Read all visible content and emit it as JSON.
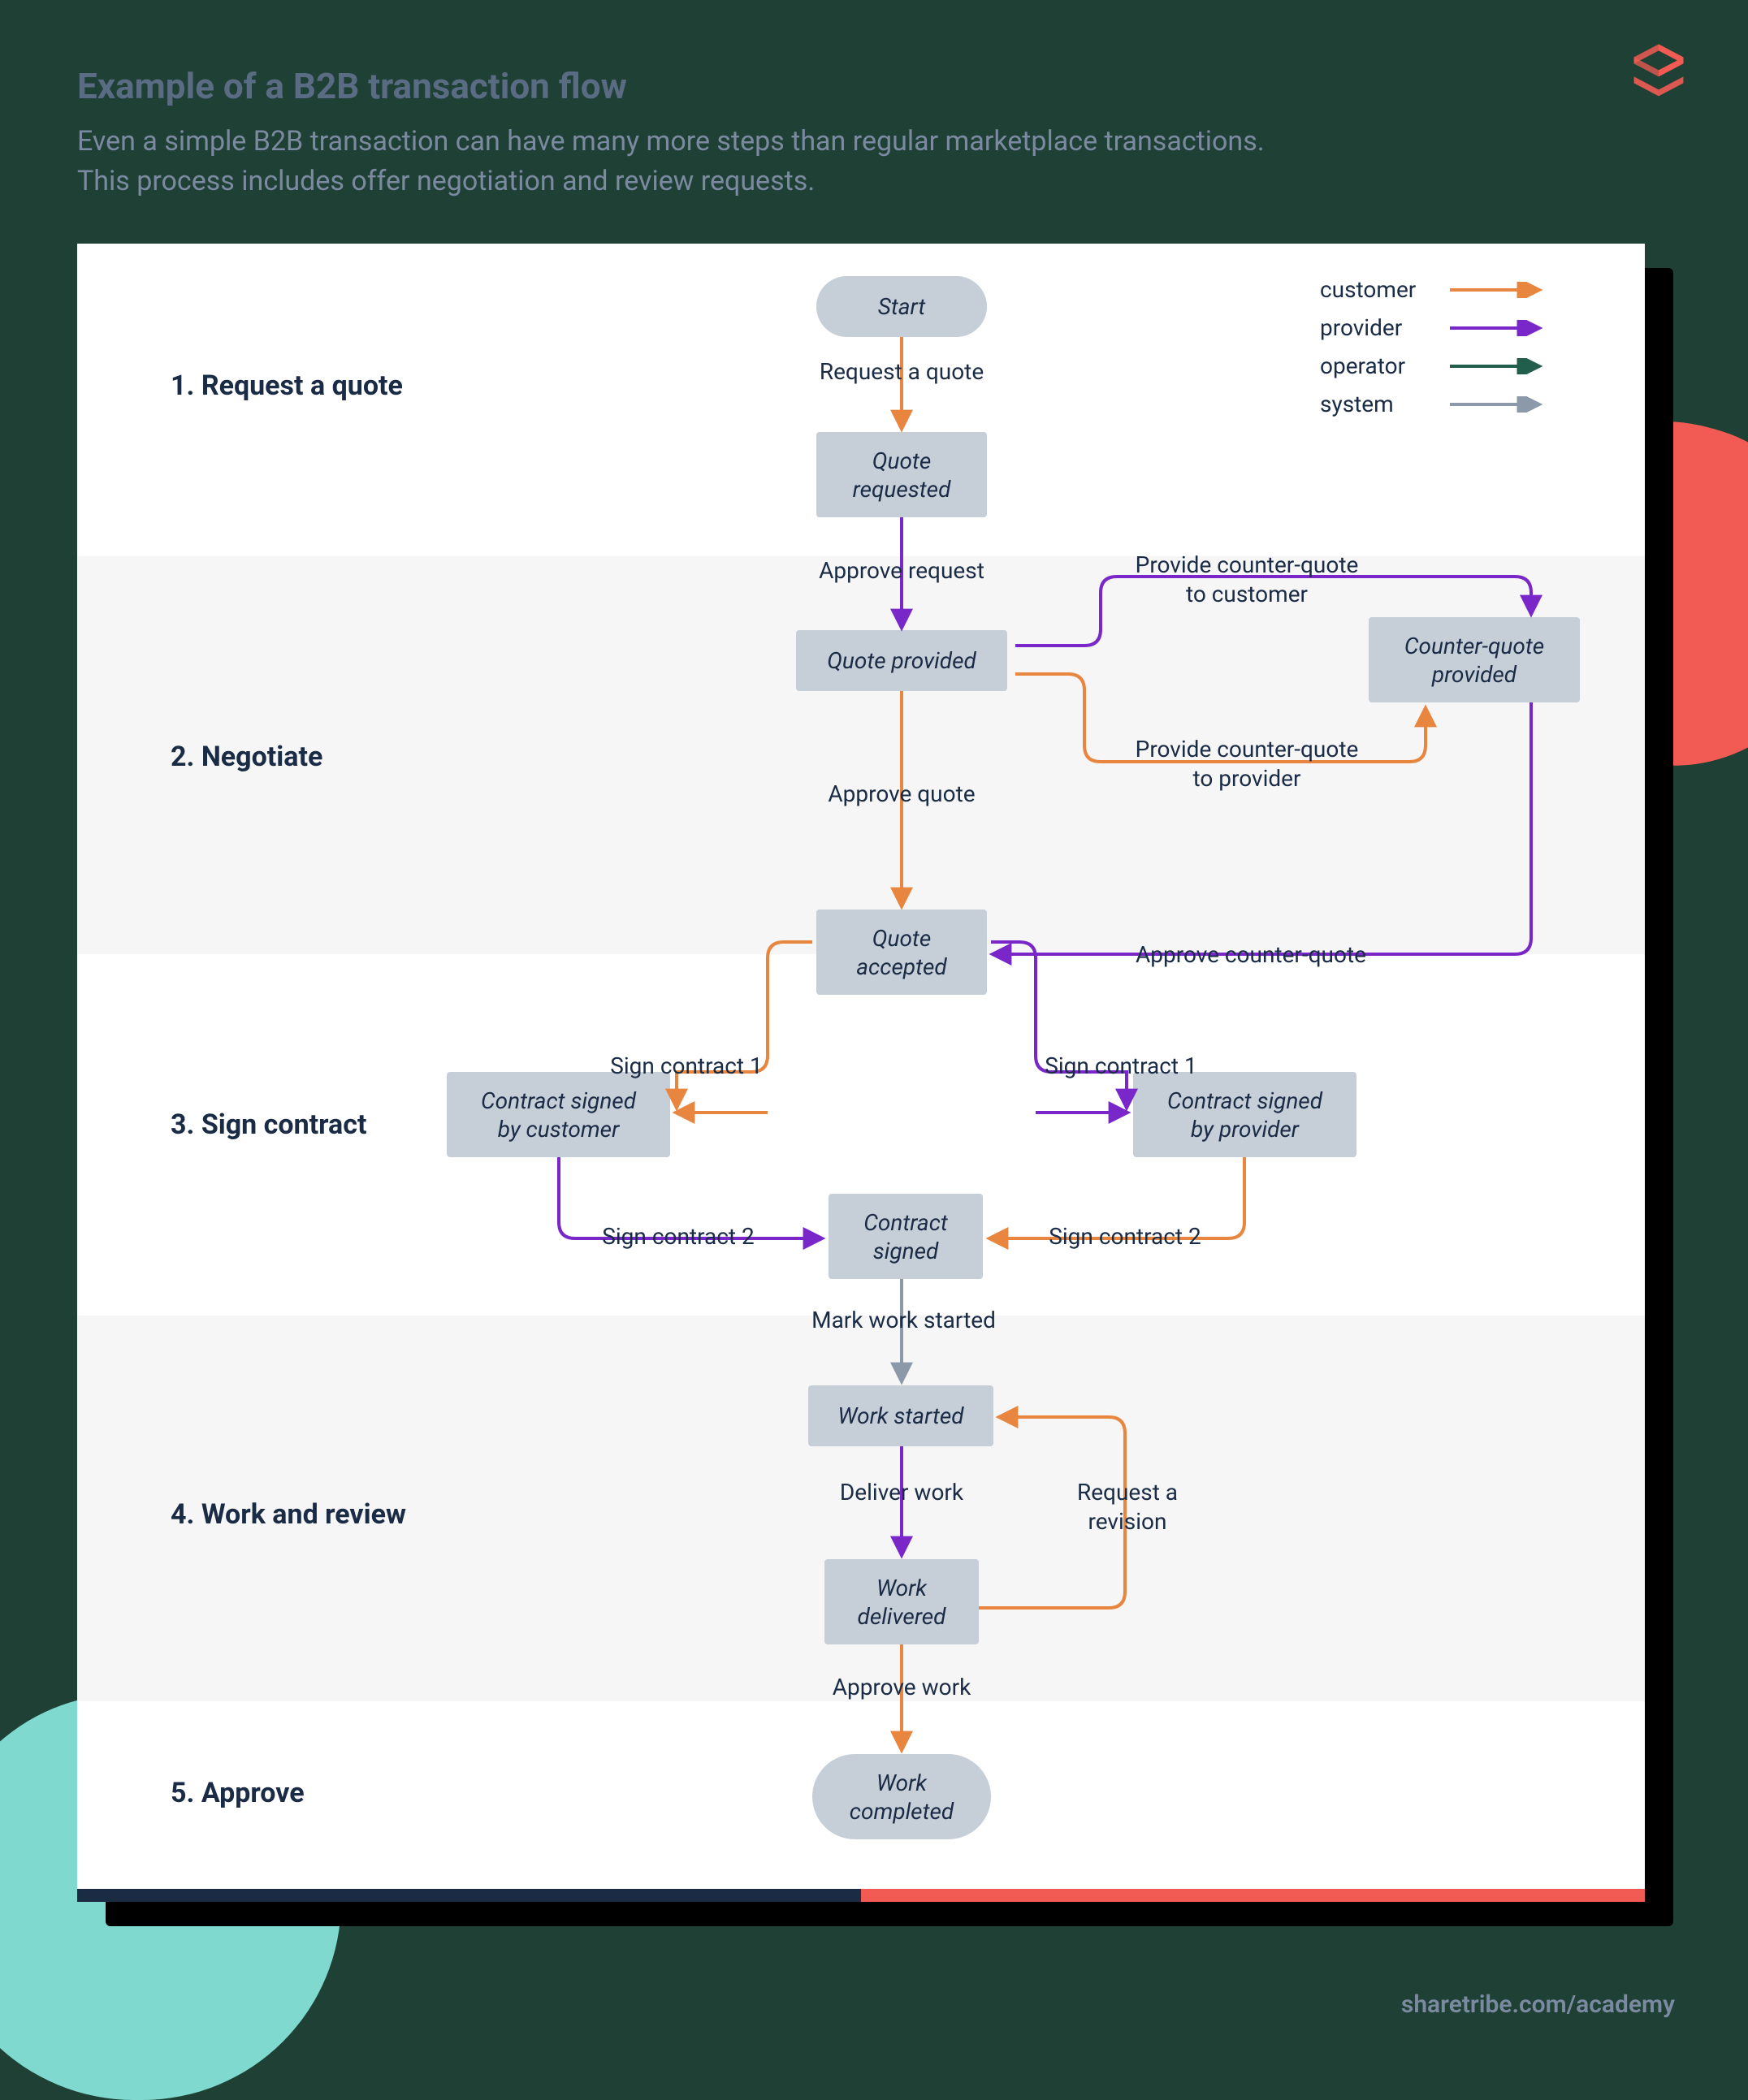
{
  "title": "Example of a B2B transaction flow",
  "subtitle": "Even a simple B2B transaction can have many more steps than regular marketplace transactions.\nThis process includes offer negotiation and review requests.",
  "footer": "sharetribe.com/academy",
  "sections": {
    "s1": "1. Request a quote",
    "s2": "2. Negotiate",
    "s3": "3. Sign contract",
    "s4": "4. Work and review",
    "s5": "5. Approve"
  },
  "states": {
    "start": "Start",
    "quote_requested": "Quote\nrequested",
    "quote_provided": "Quote provided",
    "counter_quote_provided": "Counter-quote\nprovided",
    "quote_accepted": "Quote\naccepted",
    "contract_signed_customer": "Contract signed\nby customer",
    "contract_signed_provider": "Contract signed\nby provider",
    "contract_signed": "Contract\nsigned",
    "work_started": "Work started",
    "work_delivered": "Work\ndelivered",
    "work_completed": "Work\ncompleted"
  },
  "transitions": {
    "request_quote": "Request a quote",
    "approve_request": "Approve request",
    "provide_cq_to_customer": "Provide counter-quote\nto customer",
    "provide_cq_to_provider": "Provide counter-quote\nto provider",
    "approve_quote": "Approve quote",
    "approve_counter_quote": "Approve counter-quote",
    "sign_contract_1": "Sign contract 1",
    "sign_contract_2": "Sign contract 2",
    "mark_work_started": "Mark work started",
    "deliver_work": "Deliver work",
    "request_revision": "Request a\nrevision",
    "approve_work": "Approve work"
  },
  "legend": {
    "customer": "customer",
    "provider": "provider",
    "operator": "operator",
    "system": "system"
  },
  "colors": {
    "customer": "#e8853e",
    "provider": "#7a27c9",
    "operator": "#215e4b",
    "system": "#8c99a8"
  }
}
